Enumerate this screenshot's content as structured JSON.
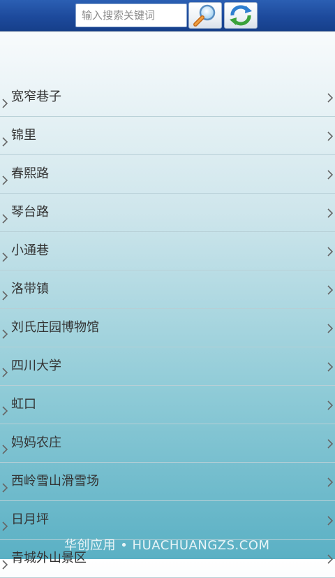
{
  "search": {
    "placeholder": "输入搜索关键词",
    "value": ""
  },
  "icons": {
    "search": "magnifier-icon",
    "refresh": "refresh-icon",
    "chevron": "chevron-right-icon"
  },
  "list": {
    "items": [
      {
        "label": "宽窄巷子"
      },
      {
        "label": "锦里"
      },
      {
        "label": "春熙路"
      },
      {
        "label": "琴台路"
      },
      {
        "label": "小通巷"
      },
      {
        "label": "洛带镇"
      },
      {
        "label": "刘氏庄园博物馆"
      },
      {
        "label": "四川大学"
      },
      {
        "label": "虹口"
      },
      {
        "label": "妈妈农庄"
      },
      {
        "label": "西岭雪山滑雪场"
      },
      {
        "label": "日月坪"
      },
      {
        "label": "青城外山景区"
      }
    ]
  },
  "watermark": {
    "text": "华创应用 • HUACHUANGZS.COM"
  },
  "colors": {
    "topbar": "#1d4a9c",
    "accent_green": "#3aa23a",
    "text": "#333333"
  }
}
